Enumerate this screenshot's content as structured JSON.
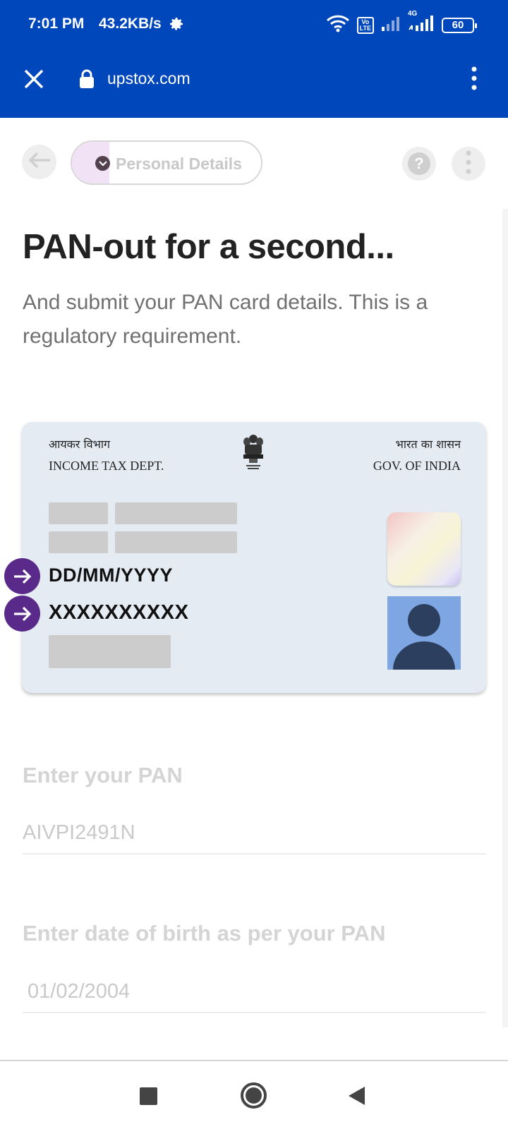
{
  "status_bar": {
    "time": "7:01 PM",
    "speed": "43.2KB/s",
    "volte": "Vo\nLTE",
    "network": "4G",
    "battery": "60"
  },
  "browser": {
    "url": "upstox.com"
  },
  "toolbar": {
    "step_label": "Personal Details",
    "help_symbol": "?"
  },
  "page": {
    "title": "PAN-out for a second...",
    "subtitle": "And submit your PAN card details. This is a regulatory requirement."
  },
  "pan_card": {
    "hindi_left": "आयकर विभाग",
    "dept": "INCOME TAX DEPT.",
    "hindi_right": "भारत का शासन",
    "gov": "GOV. OF INDIA",
    "dob_format": "DD/MM/YYYY",
    "pan_format": "XXXXXXXXXX"
  },
  "form": {
    "pan_label": "Enter your PAN",
    "pan_placeholder": "AIVPI2491N",
    "dob_label": "Enter date of birth as per your PAN",
    "dob_placeholder": "01/02/2004"
  },
  "colors": {
    "browser_bar": "#0047bb",
    "accent_purple": "#5a2a8a",
    "card_bg": "#e4ebf3"
  }
}
